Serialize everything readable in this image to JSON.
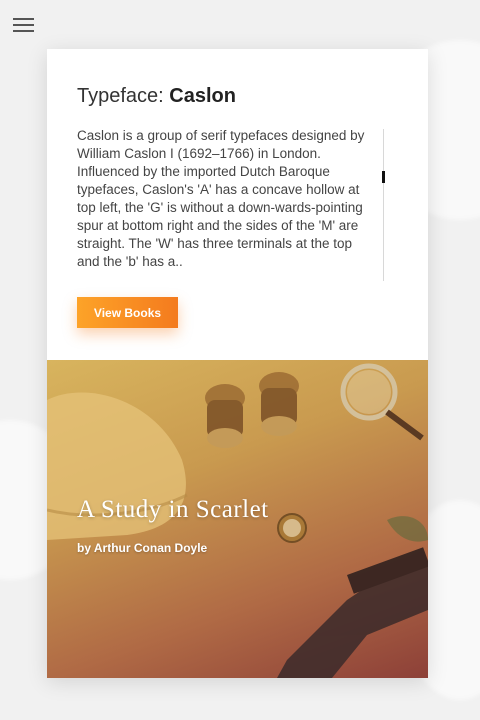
{
  "icons": {
    "menu": "hamburger-menu-icon"
  },
  "card": {
    "title_prefix": "Typeface:",
    "title_name": "Caslon",
    "description": "Caslon is a group of serif typefaces designed by William Caslon I (1692–1766) in London. Influenced by the imported Dutch Baroque typefaces, Caslon's 'A' has a concave hollow at top left, the 'G' is without a down-wards-pointing spur at bottom right and the sides of the 'M' are straight. The 'W' has three terminals at the top and the 'b' has a..",
    "button_label": "View Books"
  },
  "hero": {
    "title": "A Study in Scarlet",
    "author": "by Arthur Conan Doyle"
  },
  "colors": {
    "accent_start": "#fda328",
    "accent_end": "#f47b1e",
    "hero_top": "#d8b45e",
    "hero_bottom": "#8d4038"
  }
}
